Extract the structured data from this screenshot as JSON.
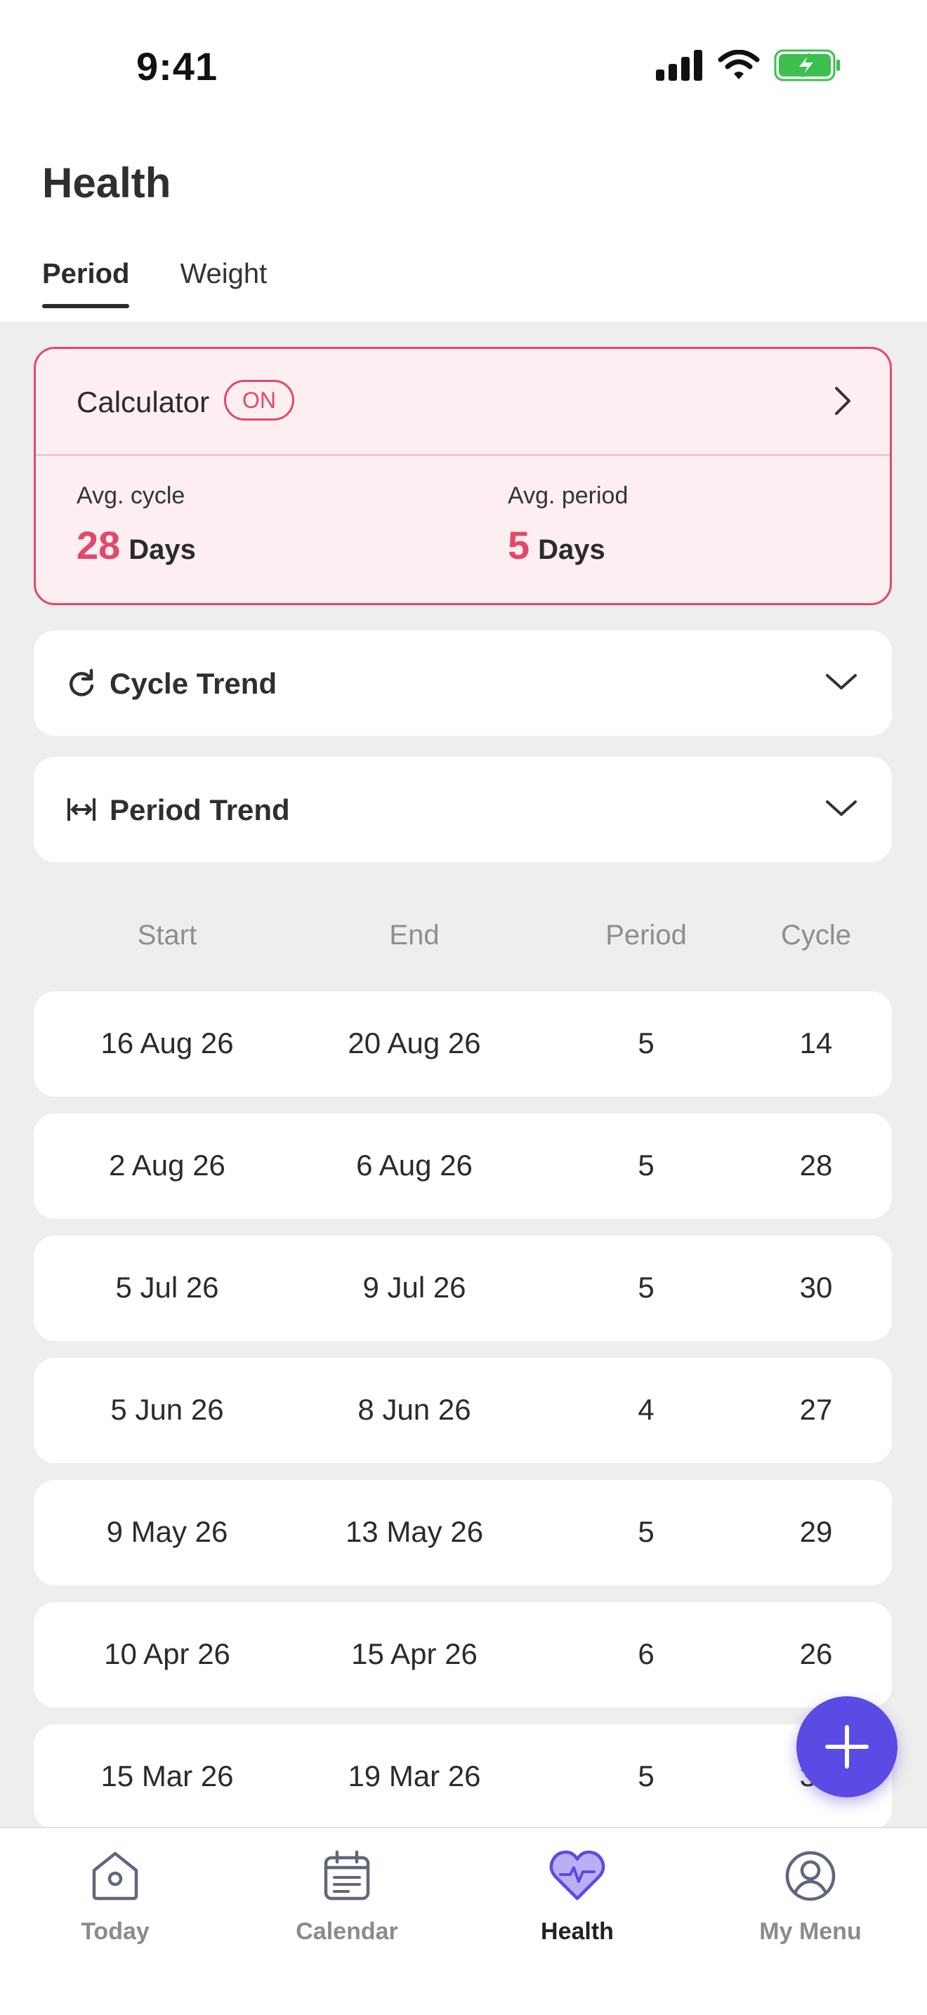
{
  "status_bar": {
    "time": "9:41"
  },
  "header": {
    "title": "Health",
    "tabs": [
      {
        "label": "Period",
        "active": true
      },
      {
        "label": "Weight",
        "active": false
      }
    ]
  },
  "calculator": {
    "title": "Calculator",
    "status_badge": "ON",
    "avg_cycle": {
      "label": "Avg. cycle",
      "value": "28",
      "unit": "Days"
    },
    "avg_period": {
      "label": "Avg. period",
      "value": "5",
      "unit": "Days"
    }
  },
  "trends": [
    {
      "label": "Cycle Trend",
      "icon": "refresh-icon"
    },
    {
      "label": "Period Trend",
      "icon": "width-arrows-icon"
    }
  ],
  "table": {
    "columns": [
      "Start",
      "End",
      "Period",
      "Cycle"
    ],
    "rows": [
      {
        "start": "16 Aug 26",
        "end": "20 Aug 26",
        "period": "5",
        "cycle": "14"
      },
      {
        "start": "2 Aug 26",
        "end": "6 Aug 26",
        "period": "5",
        "cycle": "28"
      },
      {
        "start": "5 Jul 26",
        "end": "9 Jul 26",
        "period": "5",
        "cycle": "30"
      },
      {
        "start": "5 Jun 26",
        "end": "8 Jun 26",
        "period": "4",
        "cycle": "27"
      },
      {
        "start": "9 May 26",
        "end": "13 May 26",
        "period": "5",
        "cycle": "29"
      },
      {
        "start": "10 Apr 26",
        "end": "15 Apr 26",
        "period": "6",
        "cycle": "26"
      },
      {
        "start": "15 Mar 26",
        "end": "19 Mar 26",
        "period": "5",
        "cycle": "31"
      }
    ]
  },
  "bottom_nav": [
    {
      "label": "Today",
      "icon": "home-icon",
      "active": false
    },
    {
      "label": "Calendar",
      "icon": "calendar-icon",
      "active": false
    },
    {
      "label": "Health",
      "icon": "heart-pulse-icon",
      "active": true
    },
    {
      "label": "My Menu",
      "icon": "user-circle-icon",
      "active": false
    }
  ],
  "colors": {
    "accent": "#e2486a",
    "calculator_bg": "#fdeef1",
    "primary": "#5b4ae4",
    "page_bg": "#eeeeee"
  }
}
